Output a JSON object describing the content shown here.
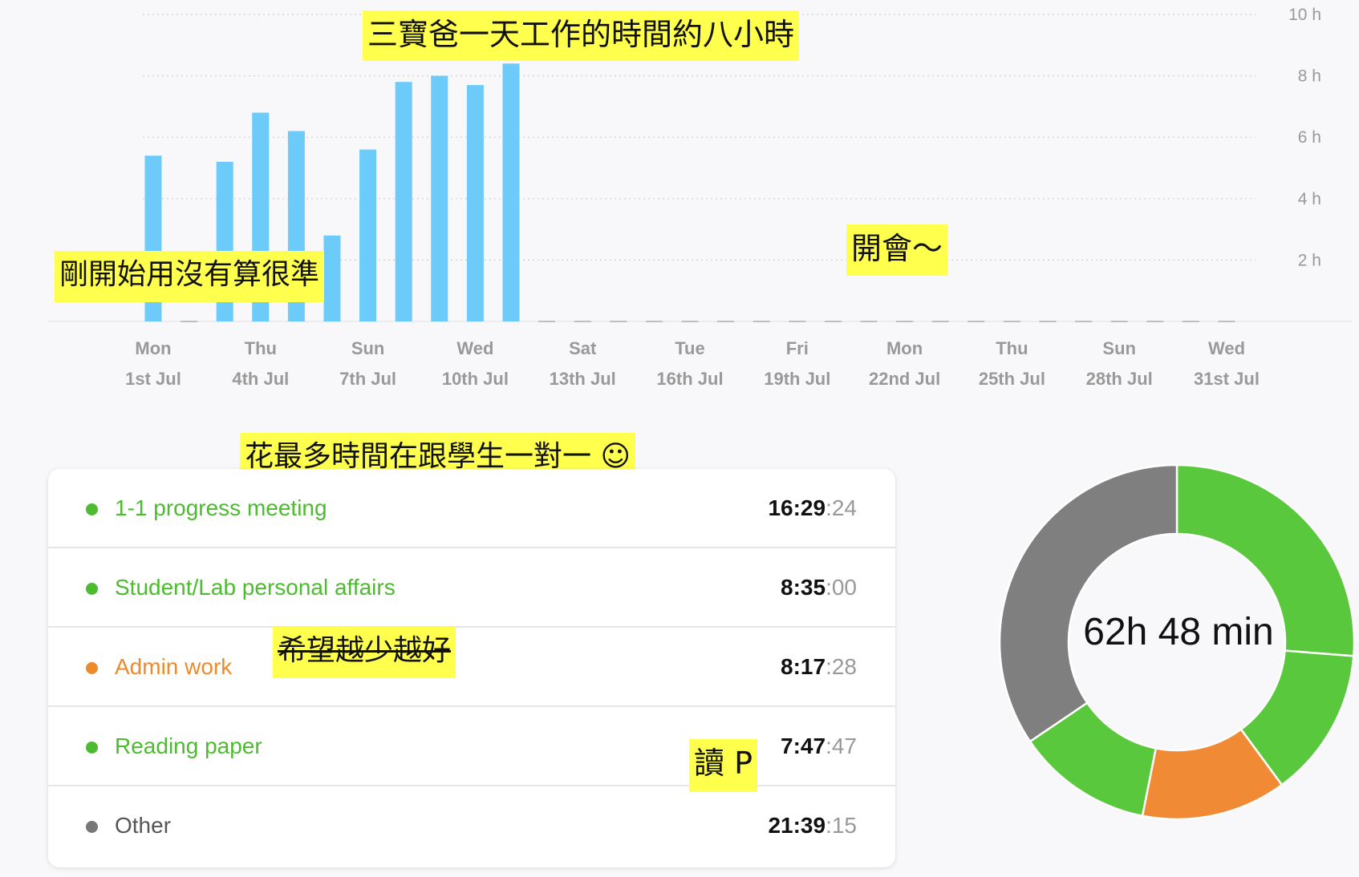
{
  "chart_data": {
    "type": "bar",
    "categories": [
      "1st Jul",
      "2nd Jul",
      "3rd Jul",
      "4th Jul",
      "5th Jul",
      "6th Jul",
      "7th Jul",
      "8th Jul",
      "9th Jul",
      "10th Jul",
      "11th Jul",
      "12th Jul",
      "13th Jul",
      "14th Jul",
      "15th Jul",
      "16th Jul",
      "17th Jul",
      "18th Jul",
      "19th Jul",
      "20th Jul",
      "21st Jul",
      "22nd Jul",
      "23rd Jul",
      "24th Jul",
      "25th Jul",
      "26th Jul",
      "27th Jul",
      "28th Jul",
      "29th Jul",
      "30th Jul",
      "31st Jul"
    ],
    "values": [
      5.4,
      0,
      5.2,
      6.8,
      6.2,
      2.8,
      5.6,
      7.8,
      8.0,
      7.7,
      8.4,
      0,
      0,
      0,
      0,
      0,
      0,
      0,
      0,
      0,
      0,
      0,
      0,
      0,
      0,
      0,
      0,
      0,
      0,
      0,
      0
    ],
    "ylim": [
      0,
      10
    ],
    "y_ticks": [
      "2 h",
      "4 h",
      "6 h",
      "8 h",
      "10 h"
    ],
    "x_labels": [
      {
        "day": "Mon",
        "date": "1st Jul"
      },
      {
        "day": "Thu",
        "date": "4th Jul"
      },
      {
        "day": "Sun",
        "date": "7th Jul"
      },
      {
        "day": "Wed",
        "date": "10th Jul"
      },
      {
        "day": "Sat",
        "date": "13th Jul"
      },
      {
        "day": "Tue",
        "date": "16th Jul"
      },
      {
        "day": "Fri",
        "date": "19th Jul"
      },
      {
        "day": "Mon",
        "date": "22nd Jul"
      },
      {
        "day": "Thu",
        "date": "25th Jul"
      },
      {
        "day": "Sun",
        "date": "28th Jul"
      },
      {
        "day": "Wed",
        "date": "31st Jul"
      }
    ],
    "grid": true,
    "bar_color": "#6ccbf9"
  },
  "notes": {
    "chart_title": "三寶爸一天工作的時間約八小時",
    "early_use": "剛開始用沒有算很準",
    "meeting": "開會～",
    "most_time": "花最多時間在跟學生一對一 ☺",
    "admin": "希望越少越好",
    "reading": "讀 P"
  },
  "activities": [
    {
      "label": "1-1 progress meeting",
      "time_main": "16:29",
      "time_sec": ":24",
      "color": "#4cbb2f",
      "dot": "#4cbb2f",
      "slice_color": "#5ac83c"
    },
    {
      "label": "Student/Lab personal affairs",
      "time_main": "8:35",
      "time_sec": ":00",
      "color": "#4cbb2f",
      "dot": "#4cbb2f",
      "slice_color": "#5ac83c"
    },
    {
      "label": "Admin work",
      "time_main": "8:17",
      "time_sec": ":28",
      "color": "#ed8a2c",
      "dot": "#ed8a2c",
      "slice_color": "#f08a35"
    },
    {
      "label": "Reading paper",
      "time_main": "7:47",
      "time_sec": ":47",
      "color": "#4cbb2f",
      "dot": "#4cbb2f",
      "slice_color": "#5ac83c"
    },
    {
      "label": "Other",
      "time_main": "21:39",
      "time_sec": ":15",
      "color": "#555555",
      "dot": "#777777",
      "slice_color": "#7f7f7f"
    }
  ],
  "donut": {
    "total_label": "62h 48 min",
    "minutes": [
      989.4,
      515,
      497.5,
      467.8,
      1299.3
    ]
  }
}
